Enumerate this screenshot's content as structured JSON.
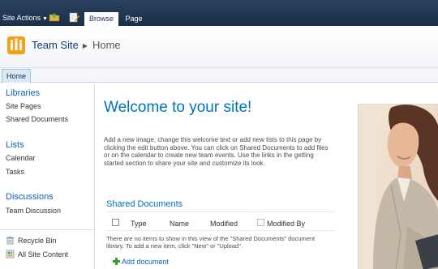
{
  "ribbon": {
    "site_actions": "Site Actions",
    "tabs": [
      {
        "label": "Browse",
        "selected": true
      },
      {
        "label": "Page",
        "selected": false
      }
    ]
  },
  "title_area": {
    "site_name": "Team Site",
    "page_name": "Home"
  },
  "top_nav": {
    "items": [
      {
        "label": "Home",
        "selected": true
      }
    ]
  },
  "quick_launch": {
    "sections": [
      {
        "heading": "Libraries",
        "items": [
          "Site Pages",
          "Shared Documents"
        ]
      },
      {
        "heading": "Lists",
        "items": [
          "Calendar",
          "Tasks"
        ]
      },
      {
        "heading": "Discussions",
        "items": [
          "Team Discussion"
        ]
      }
    ],
    "footer": [
      {
        "label": "Recycle Bin",
        "icon": "recycle-bin-icon"
      },
      {
        "label": "All Site Content",
        "icon": "site-content-icon"
      }
    ]
  },
  "main": {
    "welcome": "Welcome to your site!",
    "intro": "Add a new image, change this welcome text or add new lists to this page by clicking the edit button above. You can click on Shared Documents to add files or on the calendar to create new team events. Use the links in the getting started section to share your site and customize its look.",
    "web_part": {
      "title": "Shared Documents",
      "columns": [
        "Type",
        "Name",
        "Modified",
        "Modified By"
      ],
      "empty_message": "There are no items to show in this view of the \"Shared Documents\" document library. To add a new item, click \"New\" or \"Upload\".",
      "add_link": "Add document"
    }
  },
  "colors": {
    "ribbon": "#1f3550",
    "accent_blue": "#0072bc",
    "logo_orange": "#f6a01a"
  }
}
